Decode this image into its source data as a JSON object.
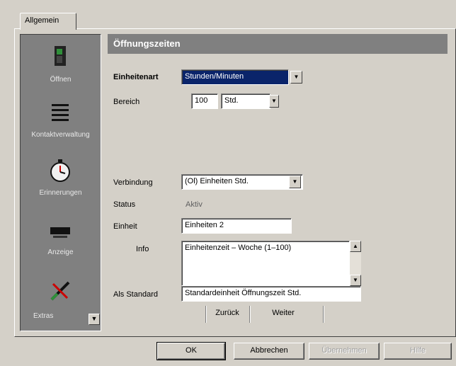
{
  "window": {
    "tab_label": "Allgemein",
    "header_title": "Öffnungszeiten"
  },
  "sidebar": {
    "items": [
      {
        "label": "Öffnen",
        "icon": "door-open-icon"
      },
      {
        "label": "Kontaktverwaltung",
        "icon": "list-icon"
      },
      {
        "label": "Erinnerungen",
        "icon": "stopwatch-icon"
      },
      {
        "label": "Anzeige",
        "icon": "display-icon"
      },
      {
        "label": "Extras",
        "icon": "tools-icon"
      }
    ]
  },
  "form": {
    "field1_label": "Einheitenart",
    "field1_value": "Stunden/Minuten",
    "field2_label": "Bereich",
    "field2_a": "100",
    "field2_b": "Std.",
    "field3_label": "Verbindung",
    "field3_value": "(Ol) Einheiten Std.",
    "field4_label": "Status",
    "field4_value": "Aktiv",
    "field5_label": "Einheit",
    "field5_value": "Einheiten 2",
    "field6_label": "Info",
    "field6_value": "Einheitenzeit – Woche (1–100)",
    "field7_label": "Als Standard",
    "field7_value": "Standardeinheit Öffnungszeit Std.",
    "small_buttons": {
      "prev": "Zurück",
      "next": "Weiter"
    }
  },
  "footer": {
    "ok_label": "OK",
    "cancel_label": "Abbrechen",
    "apply_label": "Übernehmen",
    "help_label": "Hilfe"
  }
}
